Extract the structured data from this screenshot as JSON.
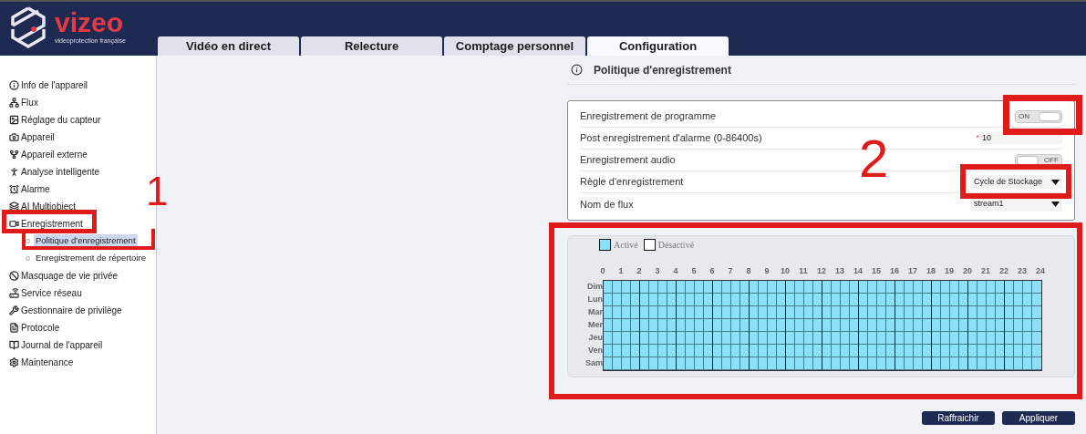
{
  "brand": {
    "name": "vizeo",
    "tagline": "videoprotection française"
  },
  "tabs": [
    {
      "label": "Vidéo en direct",
      "selected": false
    },
    {
      "label": "Relecture",
      "selected": false
    },
    {
      "label": "Comptage personnel",
      "selected": false
    },
    {
      "label": "Configuration",
      "selected": true
    }
  ],
  "sidebar": {
    "items": [
      {
        "label": "Info de l'appareil"
      },
      {
        "label": "Flux"
      },
      {
        "label": "Réglage du capteur"
      },
      {
        "label": "Appareil"
      },
      {
        "label": "Appareil externe"
      },
      {
        "label": "Analyse intelligente"
      },
      {
        "label": "Alarme"
      },
      {
        "label": "AI Multiobject"
      },
      {
        "label": "Enregistrement",
        "children": [
          {
            "label": "Politique d'enregistrement",
            "selected": true
          },
          {
            "label": "Enregistrement de répertoire",
            "selected": false
          }
        ]
      },
      {
        "label": "Masquage de vie privée"
      },
      {
        "label": "Service réseau"
      },
      {
        "label": "Gestionnaire de privilège"
      },
      {
        "label": "Protocole"
      },
      {
        "label": "Journal de l'appareil"
      },
      {
        "label": "Maintenance"
      }
    ]
  },
  "page_title": "Politique d'enregistrement",
  "form": [
    {
      "kind": "toggle",
      "label": "Enregistrement de programme",
      "on": true,
      "toggle_text": "ON"
    },
    {
      "kind": "input",
      "label": "Post enregistrement d'alarme (0-86400s)",
      "required_mark": "*",
      "value": "10"
    },
    {
      "kind": "toggle",
      "label": "Enregistrement audio",
      "on": false,
      "toggle_text": "OFF"
    },
    {
      "kind": "select",
      "label": "Règle d'enregistrement",
      "value": "Cycle de Stockage"
    },
    {
      "kind": "select",
      "label": "Nom de flux",
      "value": "stream1"
    }
  ],
  "schedule": {
    "legend": [
      {
        "label": "Activé",
        "color": "#8be0f8"
      },
      {
        "label": "Désactivé",
        "color": "#ffffff"
      }
    ],
    "hours": [
      "0",
      "1",
      "2",
      "3",
      "4",
      "5",
      "6",
      "7",
      "8",
      "9",
      "10",
      "11",
      "12",
      "13",
      "14",
      "15",
      "16",
      "17",
      "18",
      "19",
      "20",
      "21",
      "22",
      "23",
      "24"
    ],
    "days": [
      {
        "label": "Dim",
        "active": true
      },
      {
        "label": "Lun",
        "active": true
      },
      {
        "label": "Mar",
        "active": true
      },
      {
        "label": "Mer",
        "active": true
      },
      {
        "label": "Jeu",
        "active": true
      },
      {
        "label": "Ven",
        "active": true
      },
      {
        "label": "Sam",
        "active": true
      }
    ]
  },
  "buttons": [
    "Raffraichir",
    "Appliquer"
  ],
  "annotations": [
    "1",
    "2"
  ]
}
